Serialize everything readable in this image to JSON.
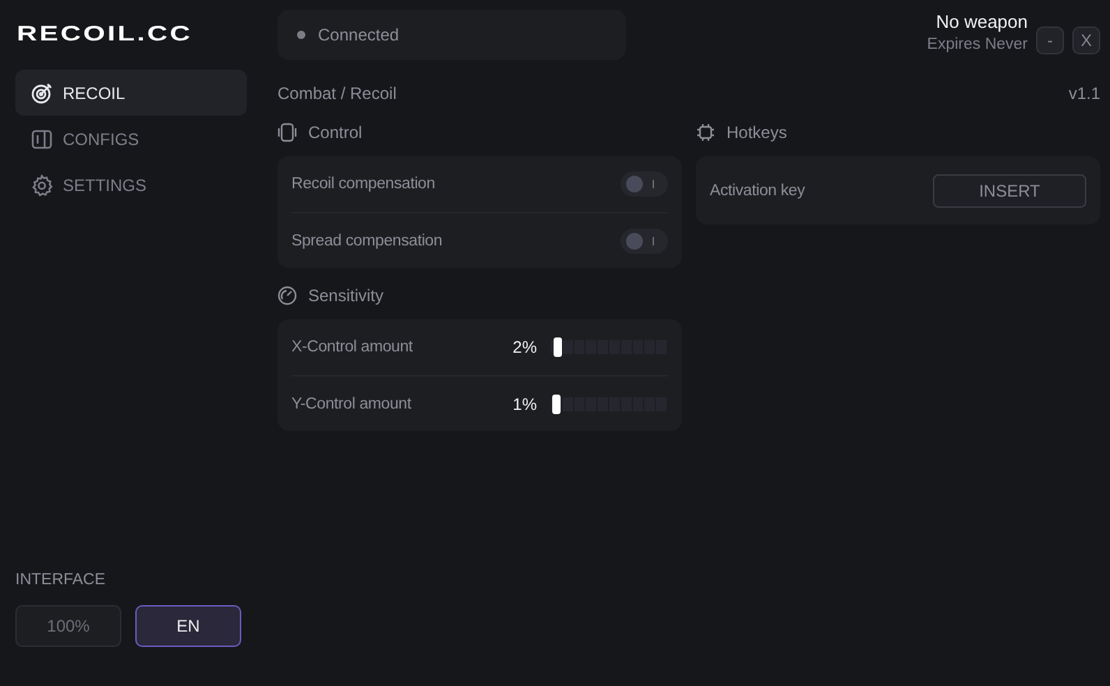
{
  "logo": "RECOIL.CC",
  "sidebar": {
    "items": [
      {
        "label": "RECOIL",
        "selected": true
      },
      {
        "label": "CONFIGS",
        "selected": false
      },
      {
        "label": "SETTINGS",
        "selected": false
      }
    ]
  },
  "interface": {
    "label": "INTERFACE",
    "buttons": [
      {
        "label": "100%",
        "selected": false
      },
      {
        "label": "EN",
        "selected": true
      }
    ]
  },
  "status": {
    "text": "Connected"
  },
  "header": {
    "weapon": "No weapon",
    "expires": "Expires Never",
    "buttons": [
      "-",
      "X"
    ]
  },
  "breadcrumb": "Combat / Recoil",
  "version": "v1.1",
  "columns": [
    {
      "sections": [
        {
          "title": "Control",
          "rows": [
            {
              "kind": "toggle",
              "label": "Recoil compensation",
              "on": false
            },
            {
              "kind": "toggle",
              "label": "Spread compensation",
              "on": false
            }
          ]
        },
        {
          "title": "Sensitivity",
          "rows": [
            {
              "kind": "slider",
              "label": "X-Control amount",
              "reading": "2%",
              "level": 0.02
            },
            {
              "kind": "slider",
              "label": "Y-Control amount",
              "reading": "1%",
              "level": 0.01
            }
          ]
        }
      ]
    },
    {
      "sections": [
        {
          "title": "Hotkeys",
          "rows": [
            {
              "kind": "key",
              "label": "Activation key",
              "value": "INSERT"
            }
          ]
        }
      ]
    }
  ]
}
